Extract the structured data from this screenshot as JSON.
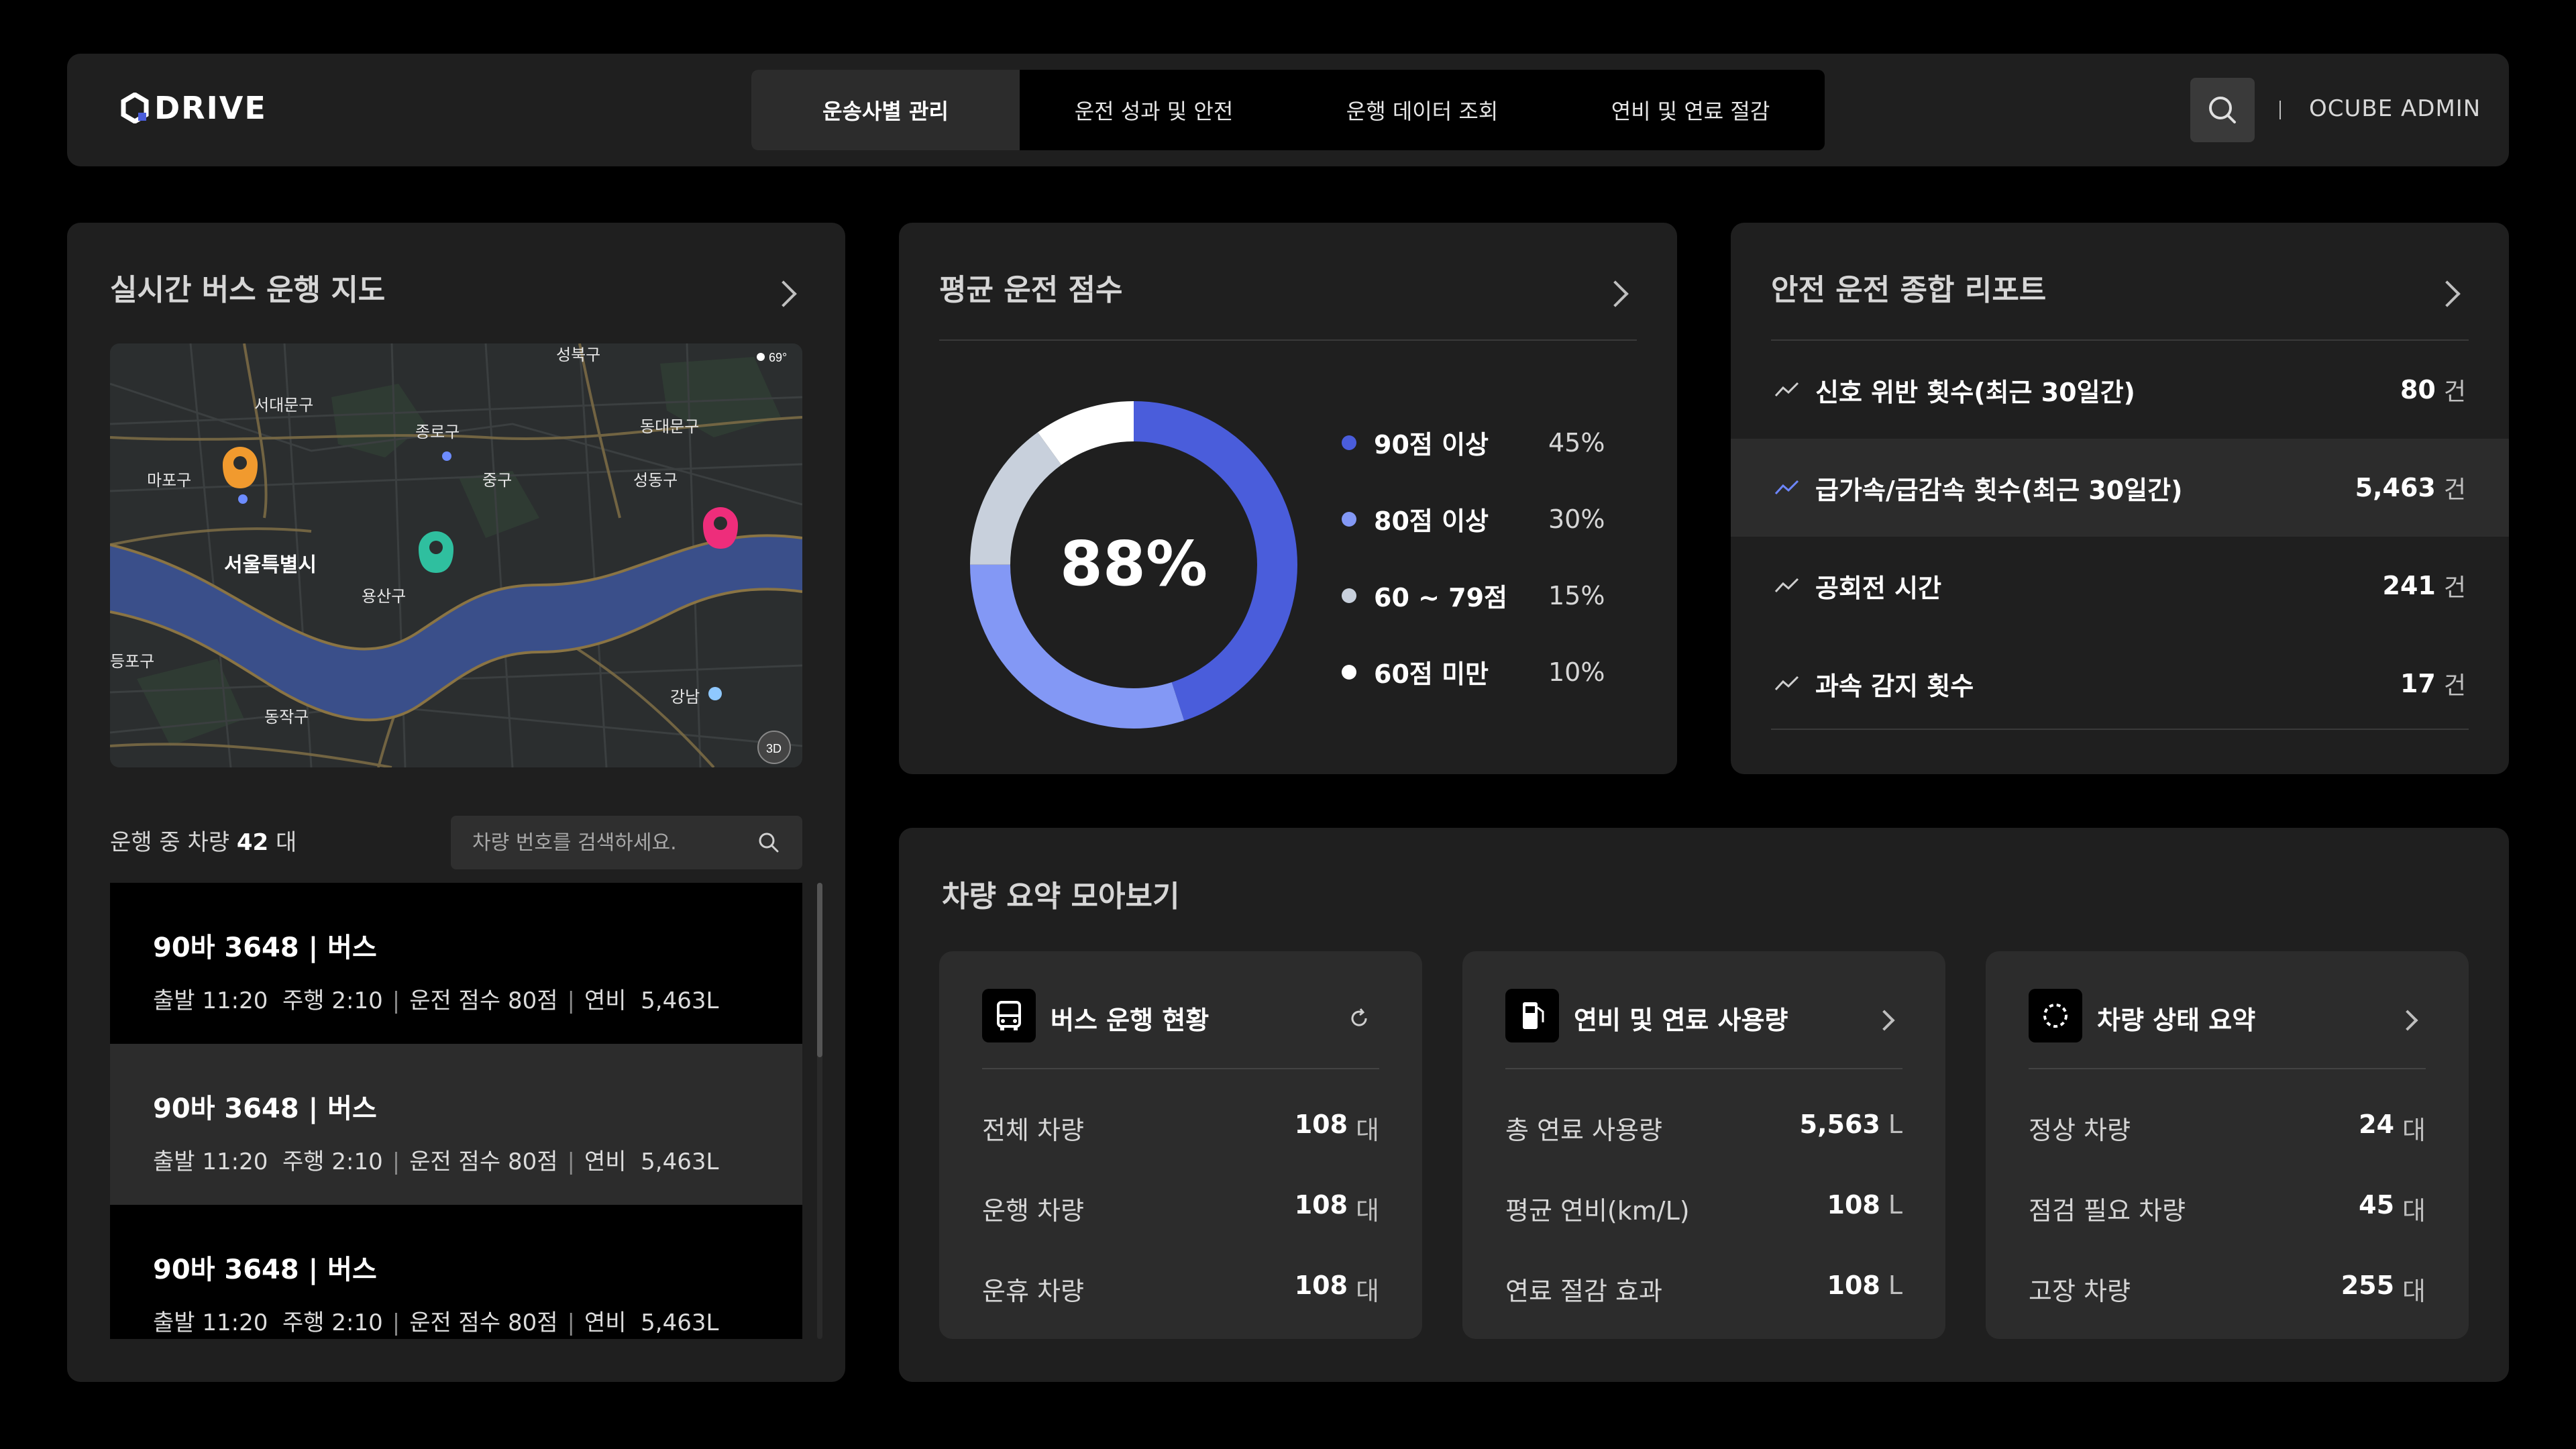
{
  "header": {
    "logo": "DRIVE",
    "nav": [
      "운송사별 관리",
      "운전 성과 및 안전",
      "운행 데이터 조회",
      "연비 및 연료 절감"
    ],
    "admin": "OCUBE ADMIN",
    "accent": "#4a5ddb"
  },
  "map_panel": {
    "title": "실시간 버스 운행 지도",
    "labels": {
      "seongbuk": "성북구",
      "seodaemun": "서대문구",
      "jongno": "종로구",
      "dongdaemun": "동대문구",
      "mapo": "마포구",
      "jung": "중구",
      "seongdong": "성동구",
      "seoul": "서울특별시",
      "yongsan": "용산구",
      "yeongdeungpo": "등포구",
      "gangnam": "강남",
      "dongjak": "동작구",
      "temp": "69°",
      "btn3d": "3D"
    },
    "pin_colors": {
      "orange": "#f19a2e",
      "teal": "#2fbf9f",
      "pink": "#ee2d7b"
    },
    "count_prefix": "운행 중 차량",
    "count_value": "42",
    "count_unit": "대",
    "search_placeholder": "차량 번호를 검색하세요.",
    "vehicles": [
      {
        "title": "90바 3648 | 버스",
        "depart_label": "출발",
        "depart": "11:20",
        "drive_label": "주행",
        "drive": "2:10",
        "score_label": "운전 점수",
        "score": "80점",
        "fuel_label": "연비",
        "fuel": "5,463L"
      },
      {
        "title": "90바 3648 | 버스",
        "depart_label": "출발",
        "depart": "11:20",
        "drive_label": "주행",
        "drive": "2:10",
        "score_label": "운전 점수",
        "score": "80점",
        "fuel_label": "연비",
        "fuel": "5,463L"
      },
      {
        "title": "90바 3648 | 버스",
        "depart_label": "출발",
        "depart": "11:20",
        "drive_label": "주행",
        "drive": "2:10",
        "score_label": "운전 점수",
        "score": "80점",
        "fuel_label": "연비",
        "fuel": "5,463L"
      }
    ]
  },
  "score_panel": {
    "title": "평균 운전 점수",
    "center": "88%",
    "segments": [
      {
        "label": "90점 이상",
        "pct": "45%",
        "value": 45,
        "color": "#4a5ddb"
      },
      {
        "label": "80점 이상",
        "pct": "30%",
        "value": 30,
        "color": "#8398f5"
      },
      {
        "label": "60 ~ 79점",
        "pct": "15%",
        "value": 15,
        "color": "#c8d0dc"
      },
      {
        "label": "60점 미만",
        "pct": "10%",
        "value": 10,
        "color": "#ffffff"
      }
    ]
  },
  "safety_panel": {
    "title": "안전 운전 종합 리포트",
    "unit": "건",
    "rows": [
      {
        "label": "신호 위반 횟수(최근 30일간)",
        "value": "80"
      },
      {
        "label": "급가속/급감속 횟수(최근 30일간)",
        "value": "5,463"
      },
      {
        "label": "공회전 시간",
        "value": "241"
      },
      {
        "label": "과속 감지 횟수",
        "value": "17"
      }
    ]
  },
  "summary_panel": {
    "title": "차량 요약 모아보기",
    "cards": [
      {
        "title": "버스 운행 현황",
        "rows": [
          {
            "label": "전체 차량",
            "value": "108",
            "unit": "대"
          },
          {
            "label": "운행 차량",
            "value": "108",
            "unit": "대"
          },
          {
            "label": "운휴 차량",
            "value": "108",
            "unit": "대"
          }
        ]
      },
      {
        "title": "연비 및 연료 사용량",
        "rows": [
          {
            "label": "총 연료 사용량",
            "value": "5,563",
            "unit": "L"
          },
          {
            "label": "평균 연비(km/L)",
            "value": "108",
            "unit": "L"
          },
          {
            "label": "연료 절감 효과",
            "value": "108",
            "unit": "L"
          }
        ]
      },
      {
        "title": "차량 상태 요약",
        "rows": [
          {
            "label": "정상 차량",
            "value": "24",
            "unit": "대"
          },
          {
            "label": "점검 필요 차량",
            "value": "45",
            "unit": "대"
          },
          {
            "label": "고장 차량",
            "value": "255",
            "unit": "대"
          }
        ]
      }
    ]
  }
}
